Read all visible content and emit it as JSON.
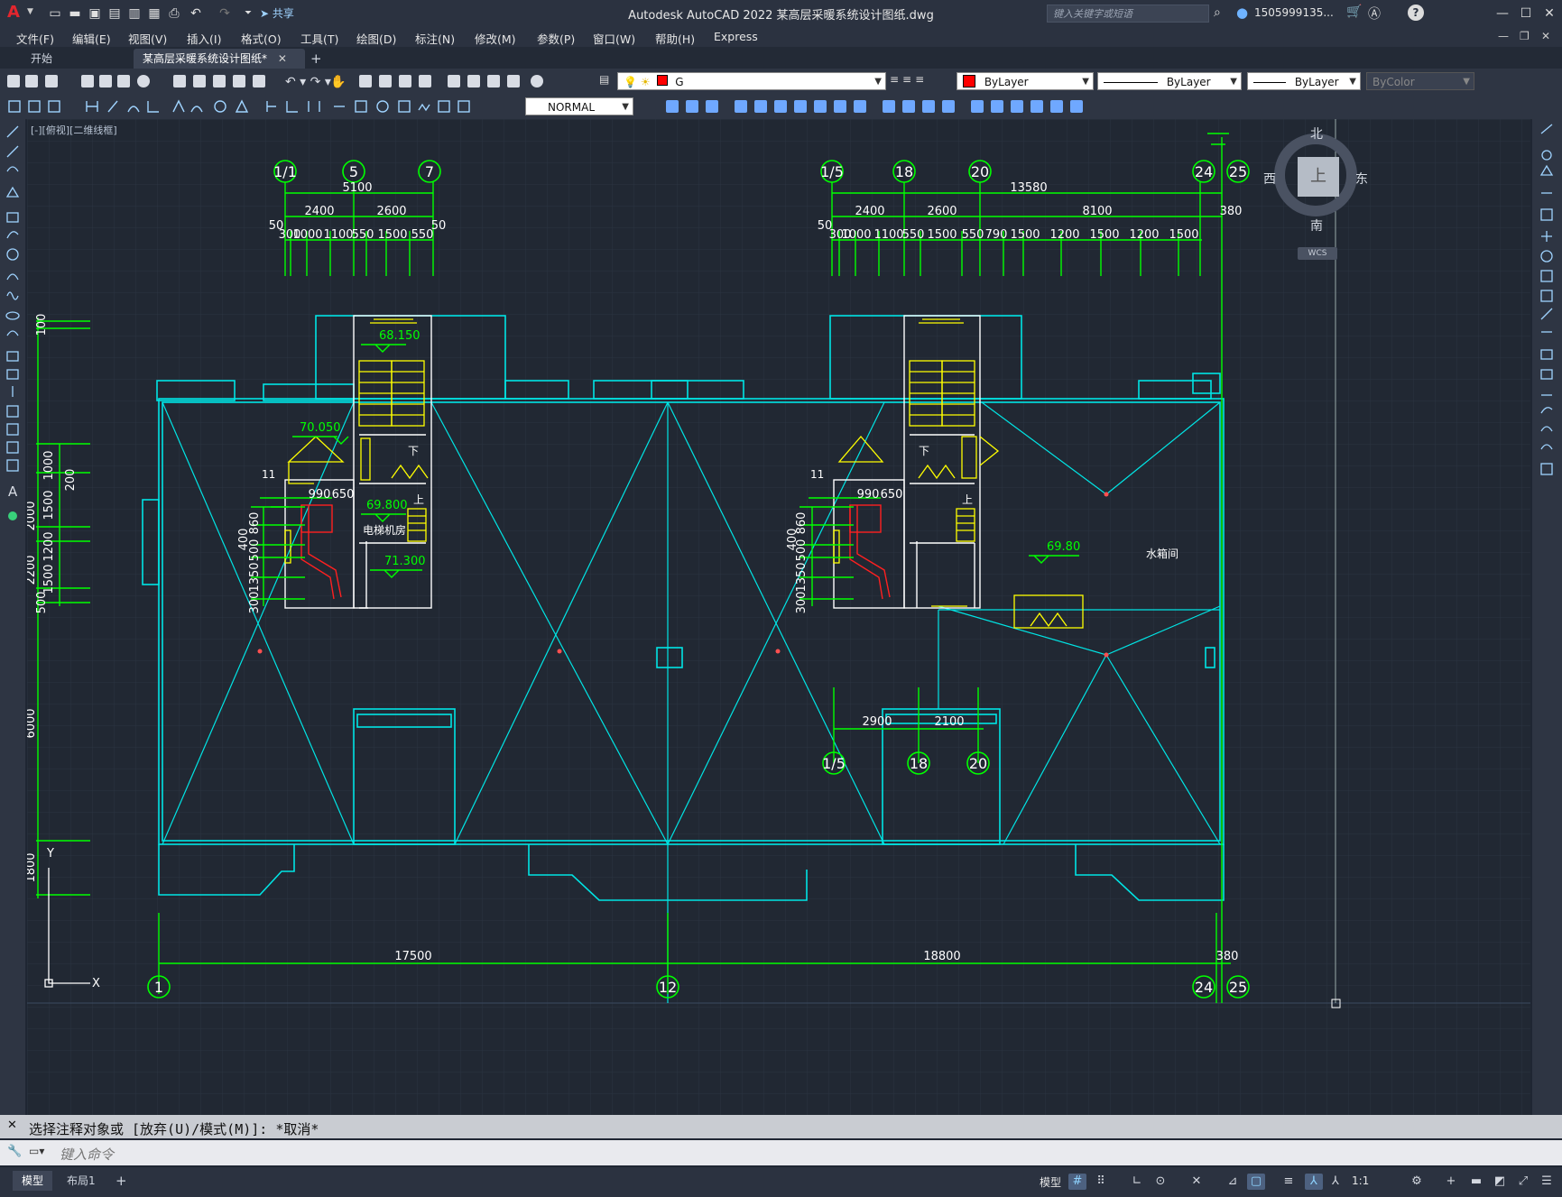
{
  "app": {
    "title": "Autodesk AutoCAD 2022    某高层采暖系统设计图纸.dwg",
    "logo": "A",
    "share_label": "共享"
  },
  "search": {
    "placeholder": "键入关键字或短语"
  },
  "user": {
    "name": "1505999135..."
  },
  "menu": [
    "文件(F)",
    "编辑(E)",
    "视图(V)",
    "插入(I)",
    "格式(O)",
    "工具(T)",
    "绘图(D)",
    "标注(N)",
    "修改(M)",
    "参数(P)",
    "窗口(W)",
    "帮助(H)",
    "Express"
  ],
  "tabs": {
    "start": "开始",
    "doc": "某高层采暖系统设计图纸*",
    "add": "+"
  },
  "properties": {
    "layer": "G",
    "color": "ByLayer",
    "linetype": "ByLayer",
    "lineweight": "ByLayer",
    "plotstyle": "ByColor",
    "dimstyle": "NORMAL"
  },
  "colors": {
    "accent_layer": "#ff0000",
    "dim": "#00ff00",
    "wall": "#00e5e5",
    "stair": "#ffff00",
    "red": "#ff2020",
    "white": "#ffffff"
  },
  "viewport": {
    "label": "[-][俯视][二维线框]"
  },
  "viewcube": {
    "north": "北",
    "south": "南",
    "east": "东",
    "west": "西",
    "top": "上",
    "wcs": "WCS"
  },
  "ucs": {
    "x": "X",
    "y": "Y"
  },
  "drawing": {
    "top_axes_left": [
      "1/1",
      "5",
      "7"
    ],
    "top_axes_right": [
      "1/5",
      "18",
      "20",
      "24",
      "25"
    ],
    "bottom_axes": [
      "1",
      "12",
      "24",
      "25"
    ],
    "inner_axes": [
      "1/5",
      "18",
      "20"
    ],
    "dims_top_left": {
      "total": "5100",
      "mid": [
        "2400",
        "2600"
      ],
      "ends": [
        "50",
        "50"
      ],
      "small": [
        "300",
        "1000",
        "1100",
        "550",
        "1500",
        "550"
      ]
    },
    "dims_top_right": {
      "total": "13580",
      "mid": [
        "2400",
        "2600",
        "8100"
      ],
      "end_l": "50",
      "end_r": "380",
      "small": [
        "300",
        "1000",
        "1100",
        "550",
        "1500",
        "550",
        "790",
        "1500",
        "1200",
        "1500",
        "1200",
        "1500"
      ]
    },
    "dims_bottom": [
      "17500",
      "18800",
      "380"
    ],
    "dims_inner": [
      "2900",
      "2100"
    ],
    "dims_left": [
      "100",
      "1000",
      "200",
      "1500",
      "1200",
      "1500",
      "500",
      "6000",
      "1800",
      "2000",
      "2200"
    ],
    "dims_stair_left": [
      "990",
      "650",
      "860",
      "400",
      "500",
      "1350",
      "300"
    ],
    "elevations": [
      "68.150",
      "70.050",
      "69.800",
      "71.300",
      "69.80"
    ],
    "labels": {
      "elevator_room": "电梯机房",
      "water_room": "水箱间",
      "down": "下",
      "up": "上",
      "n11": "11"
    }
  },
  "command": {
    "history": "选择注释对象或 [放弃(U)/模式(M)]: *取消*",
    "placeholder": "键入命令"
  },
  "status": {
    "model": "模型",
    "layout1": "布局1",
    "add": "+",
    "model_btn": "模型",
    "scale": "1:1"
  }
}
